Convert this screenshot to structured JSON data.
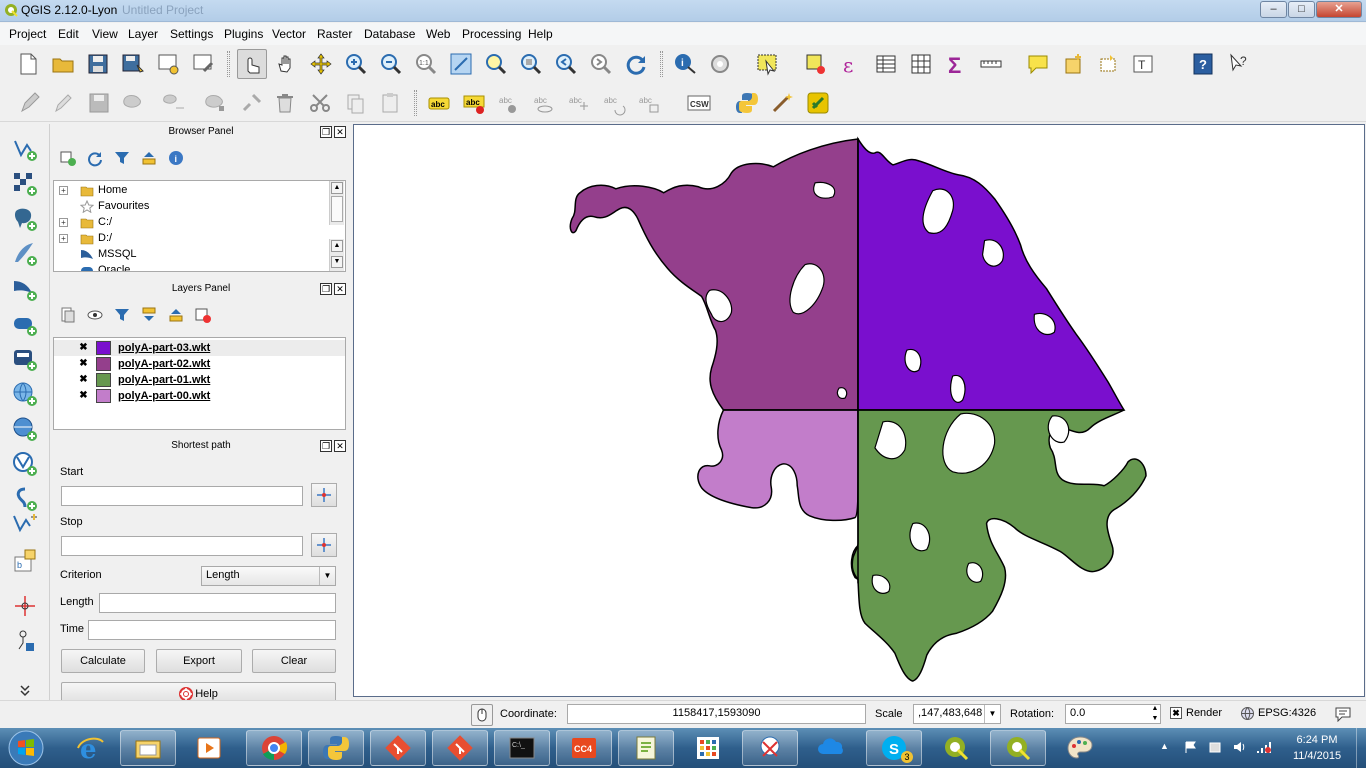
{
  "window": {
    "title": "QGIS 2.12.0-Lyon",
    "title_faded": "Untitled Project",
    "minimize": "–",
    "maximize": "□",
    "close": "✕"
  },
  "menu": [
    "Project",
    "Edit",
    "View",
    "Layer",
    "Settings",
    "Plugins",
    "Vector",
    "Raster",
    "Database",
    "Web",
    "Processing",
    "Help"
  ],
  "toolbar2": {
    "csw_label": "CSW",
    "abc": "abc"
  },
  "browser_panel": {
    "title": "Browser Panel",
    "items": [
      {
        "label": "Home",
        "icon": "folder-icon"
      },
      {
        "label": "Favourites",
        "icon": "star-icon"
      },
      {
        "label": "C:/",
        "icon": "folder-icon"
      },
      {
        "label": "D:/",
        "icon": "folder-icon"
      },
      {
        "label": "MSSQL",
        "icon": "mssql-icon"
      },
      {
        "label": "Oracle",
        "icon": "oracle-icon"
      }
    ]
  },
  "layers_panel": {
    "title": "Layers Panel",
    "layers": [
      {
        "name": "polyA-part-03.wkt",
        "color": "#7a0fce",
        "checked": "✖"
      },
      {
        "name": "polyA-part-02.wkt",
        "color": "#943f8c",
        "checked": "✖"
      },
      {
        "name": "polyA-part-01.wkt",
        "color": "#66984f",
        "checked": "✖"
      },
      {
        "name": "polyA-part-00.wkt",
        "color": "#c27dca",
        "checked": "✖"
      }
    ]
  },
  "shortest_path": {
    "title": "Shortest path",
    "start_label": "Start",
    "start_value": "",
    "stop_label": "Stop",
    "stop_value": "",
    "criterion_label": "Criterion",
    "criterion_value": "Length",
    "length_label": "Length",
    "length_value": "",
    "time_label": "Time",
    "time_value": "",
    "calculate": "Calculate",
    "export": "Export",
    "clear": "Clear",
    "help": "Help"
  },
  "statusbar": {
    "coordinate_label": "Coordinate:",
    "coordinate_value": "1158417,1593090",
    "scale_label": "Scale",
    "scale_value": ",147,483,648",
    "rotation_label": "Rotation:",
    "rotation_value": "0.0",
    "render_label": "Render",
    "render_checked": "✖",
    "crs": "EPSG:4326"
  },
  "taskbar": {
    "time": "6:24 PM",
    "date": "11/4/2015",
    "skype_badge": "3"
  },
  "colors": {
    "part03": "#7a0fce",
    "part02": "#943f8c",
    "part01": "#66984f",
    "part00": "#c27dca"
  }
}
